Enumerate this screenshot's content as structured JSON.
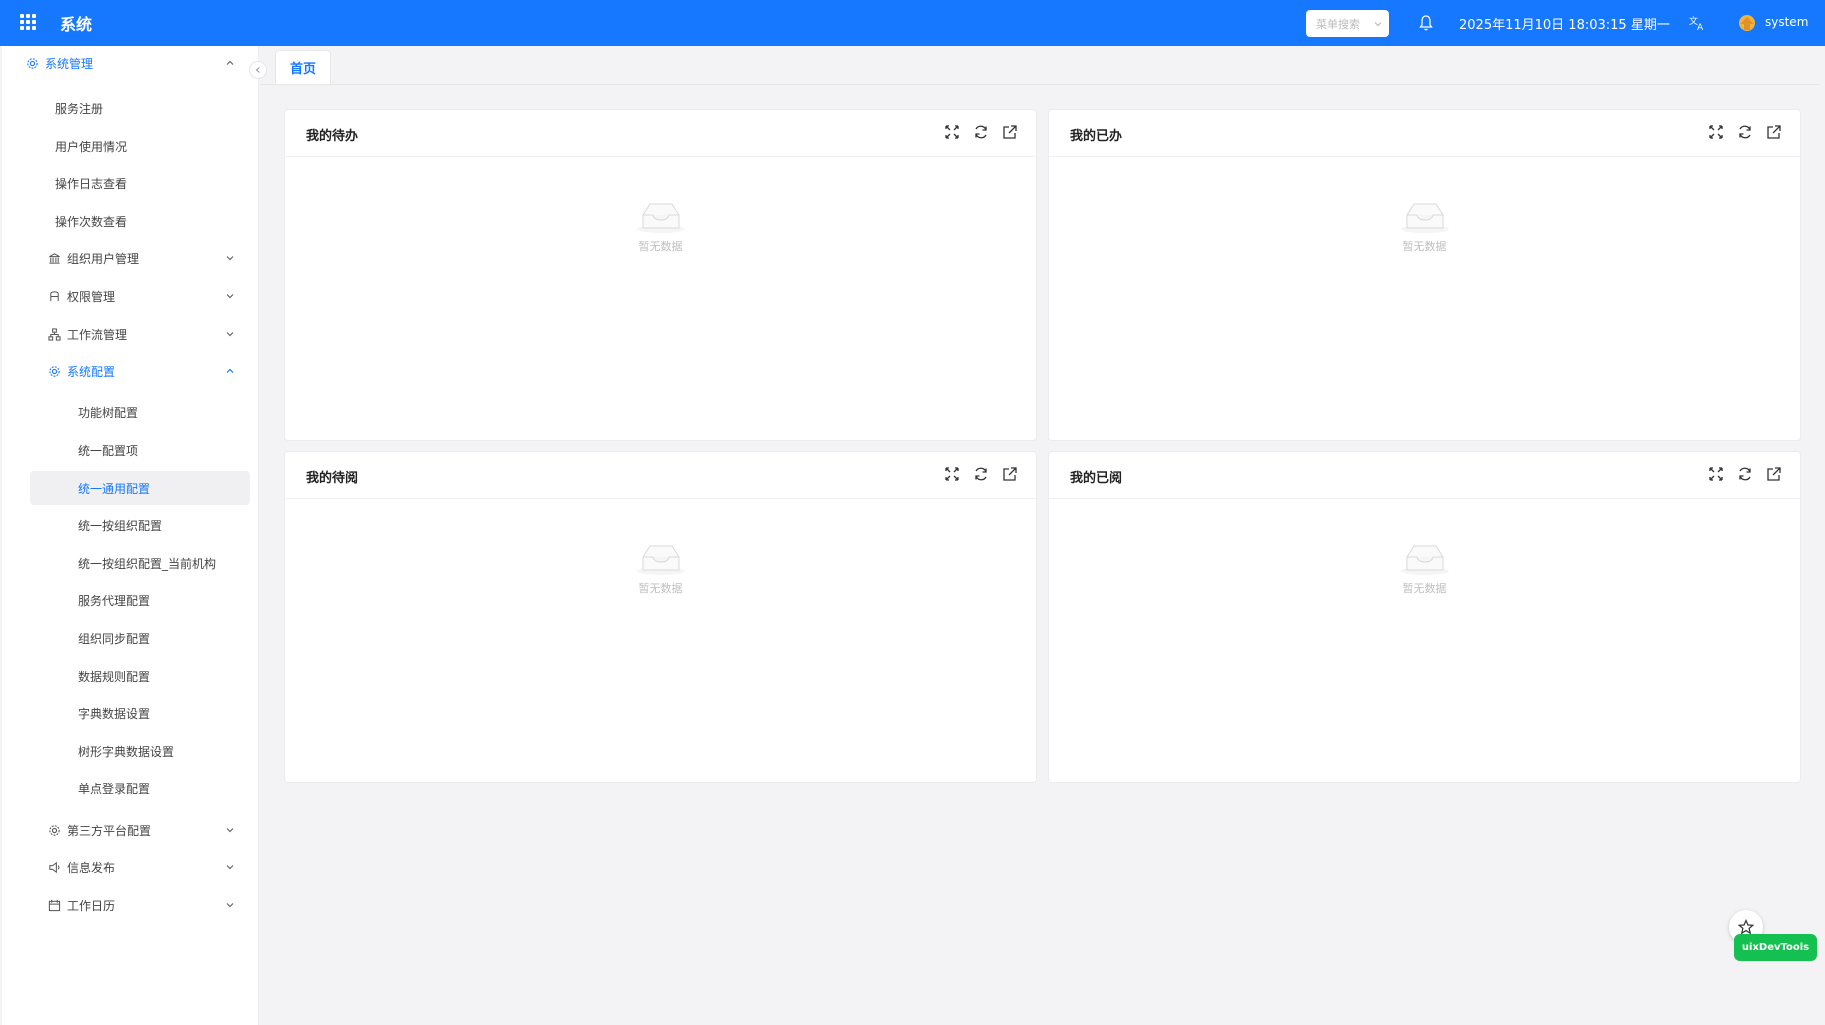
{
  "header": {
    "title": "系统",
    "search_placeholder": "菜单搜索",
    "datetime": "2025年11月10日 18:03:15 星期一",
    "username": "system",
    "color": "#1677ff"
  },
  "sidebar": {
    "items": [
      {
        "label": "系统管理",
        "icon": "gear-icon"
      },
      {
        "label": "服务注册"
      },
      {
        "label": "用户使用情况"
      },
      {
        "label": "操作日志查看"
      },
      {
        "label": "操作次数查看"
      },
      {
        "label": "组织用户管理",
        "icon": "bank-icon"
      },
      {
        "label": "权限管理",
        "icon": "permission-icon"
      },
      {
        "label": "工作流管理",
        "icon": "workflow-icon"
      },
      {
        "label": "系统配置",
        "icon": "gear-icon"
      },
      {
        "label": "功能树配置"
      },
      {
        "label": "统一配置项"
      },
      {
        "label": "统一通用配置"
      },
      {
        "label": "统一按组织配置"
      },
      {
        "label": "统一按组织配置_当前机构"
      },
      {
        "label": "服务代理配置"
      },
      {
        "label": "组织同步配置"
      },
      {
        "label": "数据规则配置"
      },
      {
        "label": "字典数据设置"
      },
      {
        "label": "树形字典数据设置"
      },
      {
        "label": "单点登录配置"
      },
      {
        "label": "第三方平台配置",
        "icon": "gear-icon"
      },
      {
        "label": "信息发布",
        "icon": "speaker-icon"
      },
      {
        "label": "工作日历",
        "icon": "calendar-icon"
      }
    ]
  },
  "tabs": [
    {
      "label": "首页"
    }
  ],
  "cards": [
    {
      "title": "我的待办",
      "empty_text": "暂无数据"
    },
    {
      "title": "我的已办",
      "empty_text": "暂无数据"
    },
    {
      "title": "我的待阅",
      "empty_text": "暂无数据"
    },
    {
      "title": "我的已阅",
      "empty_text": "暂无数据"
    }
  ],
  "devtools_label": "uixDevTools"
}
